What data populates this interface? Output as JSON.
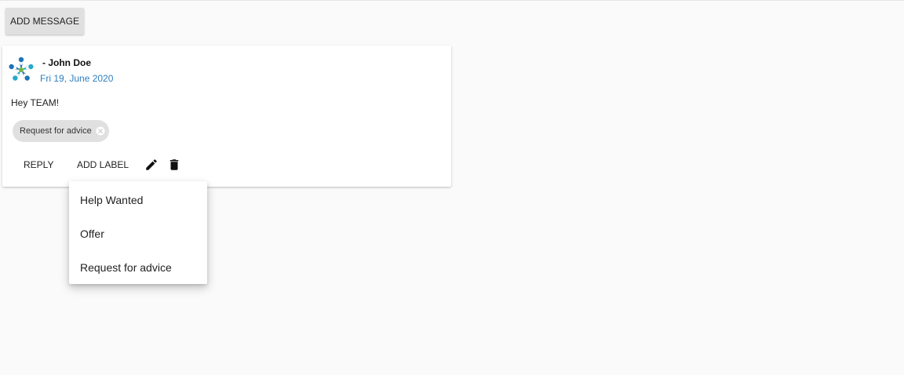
{
  "toolbar": {
    "add_message_label": "ADD MESSAGE"
  },
  "message": {
    "author": "- John Doe",
    "date": "Fri 19, June 2020",
    "text": "Hey TEAM!",
    "labels": [
      "Request for advice"
    ],
    "actions": {
      "reply_label": "REPLY",
      "add_label_label": "ADD LABEL",
      "edit_icon": "pencil-icon",
      "delete_icon": "trash-icon"
    },
    "avatar_icon": "team-logo-icon"
  },
  "label_menu": {
    "items": [
      "Help Wanted",
      "Offer",
      "Request for advice"
    ]
  },
  "colors": {
    "background": "#fafafa",
    "date_link": "#2f7fc1",
    "chip_bg": "#e0e0e0",
    "button_bg": "#e0e0e0",
    "logo_blue": "#1f73b7",
    "logo_teal": "#2aa7c9",
    "logo_green": "#7cb342"
  }
}
